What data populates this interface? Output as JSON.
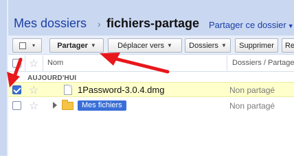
{
  "breadcrumb": {
    "root": "Mes dossiers",
    "separator": "›",
    "current": "fichiers-partage"
  },
  "share_folder_link": "Partager ce dossier",
  "toolbar": {
    "select_caret": "▾",
    "share_label": "Partager",
    "move_label": "Déplacer vers",
    "folders_label": "Dossiers",
    "delete_label": "Supprimer",
    "overflow_label": "Re"
  },
  "columns": {
    "name": "Nom",
    "sharing": "Dossiers / Partage"
  },
  "group_label": "AUJOURD'HUI",
  "rows": [
    {
      "name": "1Password-3.0.4.dmg",
      "sharing": "Non partagé",
      "checked": true,
      "type": "file"
    },
    {
      "name": "Mes fichiers",
      "sharing": "Non partagé",
      "checked": false,
      "type": "folder"
    }
  ],
  "star_glyph": "☆",
  "colors": {
    "header_bg": "#c9d7f1",
    "link_blue": "#1a3fa6",
    "selected_row": "#ffffcc",
    "arrow_red": "#e8171b",
    "folder_chip": "#3a6fd8"
  }
}
